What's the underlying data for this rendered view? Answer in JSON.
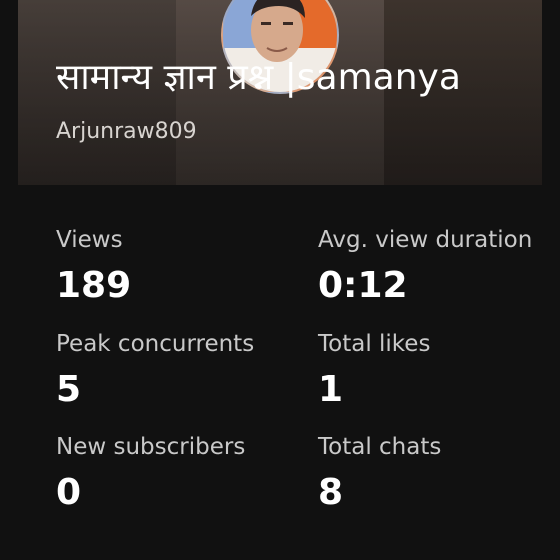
{
  "header": {
    "title": "सामान्य ज्ञान प्रश्न |samanya",
    "channel": "Arjunraw809",
    "avatar_icon": "user-avatar"
  },
  "stats": {
    "views": {
      "label": "Views",
      "value": "189"
    },
    "avg_view_duration": {
      "label": "Avg. view duration",
      "value": "0:12"
    },
    "peak_concurrents": {
      "label": "Peak concurrents",
      "value": "5"
    },
    "total_likes": {
      "label": "Total likes",
      "value": "1"
    },
    "new_subscribers": {
      "label": "New subscribers",
      "value": "0"
    },
    "total_chats": {
      "label": "Total chats",
      "value": "8"
    }
  }
}
